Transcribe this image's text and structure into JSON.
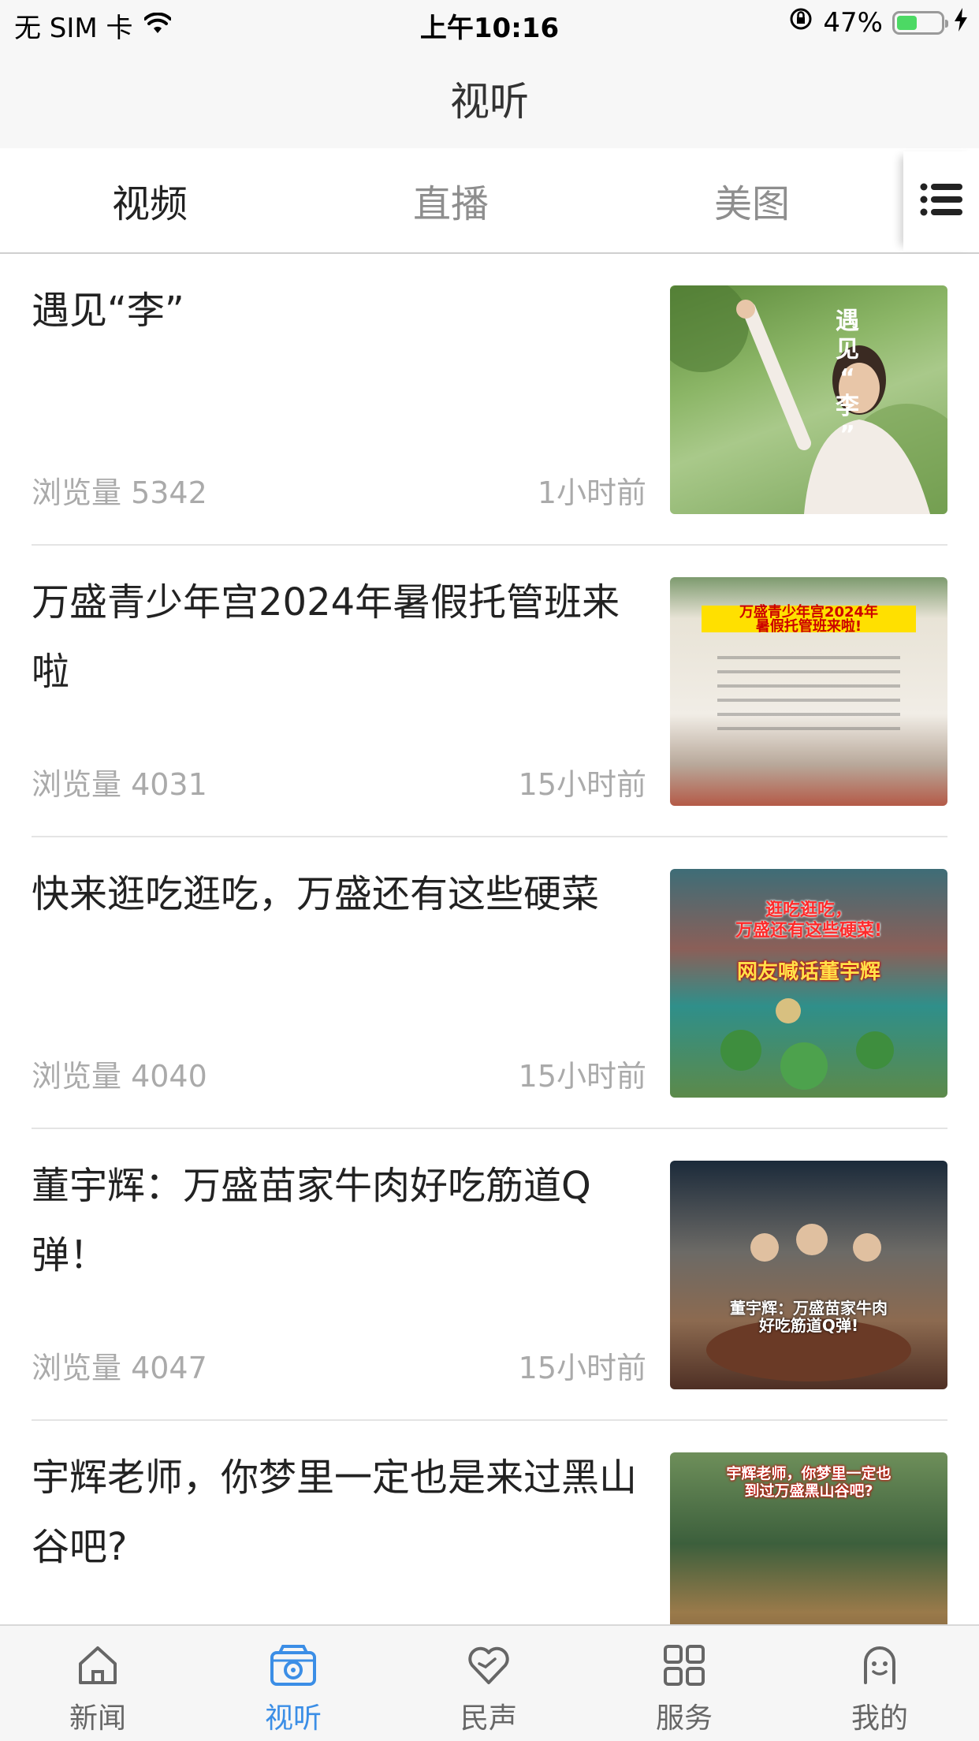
{
  "status_bar": {
    "carrier": "无 SIM 卡",
    "time": "上午10:16",
    "battery_percent_text": "47%",
    "battery_level": 0.47
  },
  "nav": {
    "title": "视听"
  },
  "tabs": [
    {
      "label": "视频",
      "active": true
    },
    {
      "label": "直播",
      "active": false
    },
    {
      "label": "美图",
      "active": false
    }
  ],
  "items": [
    {
      "title": "遇见“李”",
      "views": "浏览量 5342",
      "time": "1小时前",
      "thumb_text": [
        "遇",
        "见",
        "“",
        "李",
        "”"
      ]
    },
    {
      "title": "万盛青少年宫2024年暑假托管班来啦",
      "views": "浏览量 4031",
      "time": "15小时前",
      "thumb_text": [
        "万盛青少年宫2024年",
        "暑假托管班来啦!"
      ]
    },
    {
      "title": "快来逛吃逛吃，万盛还有这些硬菜",
      "views": "浏览量 4040",
      "time": "15小时前",
      "thumb_text": [
        "逛吃逛吃，",
        "万盛还有这些硬菜!",
        "网友喊话董宇辉"
      ]
    },
    {
      "title": "董宇辉：万盛苗家牛肉好吃筋道Q弹！",
      "views": "浏览量 4047",
      "time": "15小时前",
      "thumb_text": [
        "董宇辉：万盛苗家牛肉",
        "好吃筋道Q弹!"
      ]
    },
    {
      "title": "宇辉老师，你梦里一定也是来过黑山谷吧?",
      "views": "",
      "time": "",
      "thumb_text": [
        "宇辉老师，你梦里一定也",
        "到过万盛黑山谷吧?"
      ]
    }
  ],
  "tab_bar": [
    {
      "label": "新闻",
      "icon": "home-icon",
      "active": false
    },
    {
      "label": "视听",
      "icon": "camera-icon",
      "active": true
    },
    {
      "label": "民声",
      "icon": "heart-icon",
      "active": false
    },
    {
      "label": "服务",
      "icon": "grid-icon",
      "active": false
    },
    {
      "label": "我的",
      "icon": "profile-icon",
      "active": false
    }
  ],
  "colors": {
    "accent": "#3b8ee6",
    "text_primary": "#222222",
    "text_secondary": "#aaaaaa",
    "battery_green": "#4cd964"
  }
}
